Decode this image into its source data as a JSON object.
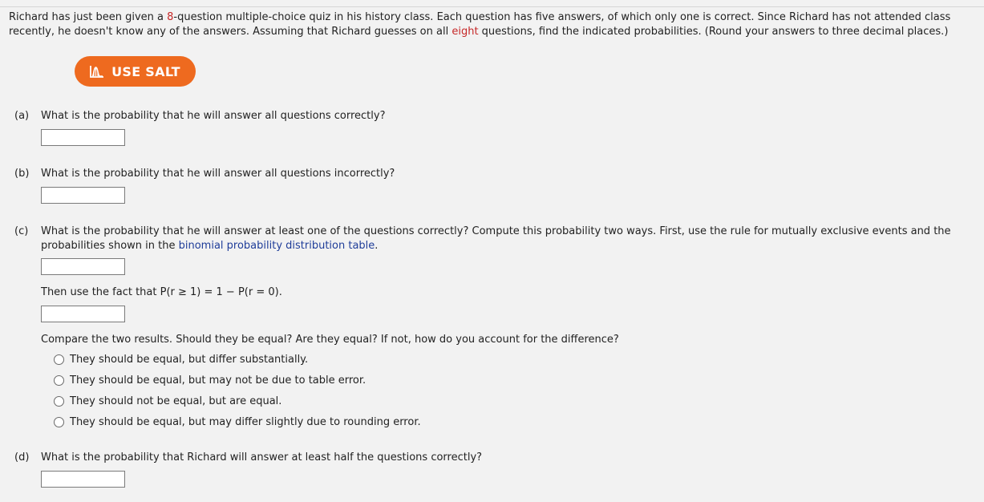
{
  "intro": {
    "part1": "Richard has just been given a ",
    "num": "8",
    "part2": "-question multiple-choice quiz in his history class. Each question has five answers, of which only one is correct. Since Richard has not attended class recently, he doesn't know any of the answers. Assuming that Richard guesses on all ",
    "word": "eight",
    "part3": " questions, find the indicated probabilities. (Round your answers to three decimal places.)"
  },
  "salt_button": {
    "label": "USE SALT",
    "icon": "chart-icon"
  },
  "questions": {
    "a": {
      "label": "(a)",
      "text": "What is the probability that he will answer all questions correctly?"
    },
    "b": {
      "label": "(b)",
      "text": "What is the probability that he will answer all questions incorrectly?"
    },
    "c": {
      "label": "(c)",
      "text_pre": "What is the probability that he will answer at least one of the questions correctly? Compute this probability two ways. First, use the rule for mutually exclusive events and the probabilities shown in the ",
      "link": "binomial probability distribution table",
      "text_post": ".",
      "then_text": "Then use the fact that P(r ≥ 1) = 1 − P(r = 0).",
      "compare_text": "Compare the two results. Should they be equal? Are they equal? If not, how do you account for the difference?",
      "options": [
        "They should be equal, but differ substantially.",
        "They should be equal, but may not be due to table error.",
        "They should not be equal, but are equal.",
        "They should be equal, but may differ slightly due to rounding error."
      ]
    },
    "d": {
      "label": "(d)",
      "text": "What is the probability that Richard will answer at least half the questions correctly?"
    }
  },
  "colors": {
    "accent": "#ee6a1f",
    "highlight": "#c62828",
    "link": "#1f3d99"
  }
}
